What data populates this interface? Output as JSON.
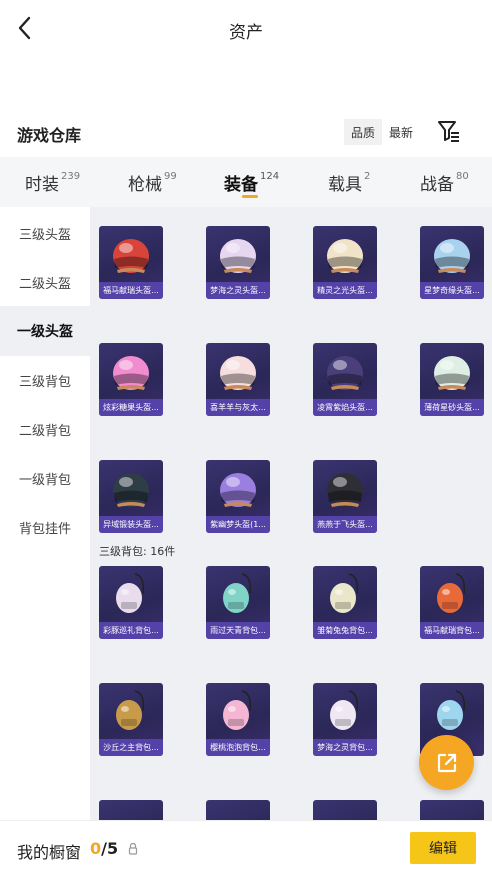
{
  "header": {
    "title": "资产"
  },
  "warehouse": {
    "title": "游戏仓库",
    "sort_options": [
      "品质",
      "最新"
    ],
    "active_sort": 1
  },
  "categories": [
    {
      "label": "时装",
      "count": "239"
    },
    {
      "label": "枪械",
      "count": "99"
    },
    {
      "label": "装备",
      "count": "124"
    },
    {
      "label": "载具",
      "count": "2"
    },
    {
      "label": "战备",
      "count": "80"
    }
  ],
  "sidebar": {
    "items": [
      {
        "label": "三级头盔"
      },
      {
        "label": "二级头盔"
      },
      {
        "label": "一级头盔"
      },
      {
        "label": "三级背包"
      },
      {
        "label": "二级背包"
      },
      {
        "label": "一级背包"
      },
      {
        "label": "背包挂件"
      }
    ]
  },
  "helmets": [
    {
      "name": "福马献瑞头盔...",
      "color": "#d9443a"
    },
    {
      "name": "梦海之灵头盔...",
      "color": "#e6d6f0"
    },
    {
      "name": "精灵之光头盔...",
      "color": "#f1e3c8"
    },
    {
      "name": "星梦奇缘头盔...",
      "color": "#a9d2ee"
    },
    {
      "name": "炫彩糖果头盔...",
      "color": "#f08ccf"
    },
    {
      "name": "喜羊羊与灰太...",
      "color": "#f6dede"
    },
    {
      "name": "凌霄紫焰头盔...",
      "color": "#4a3f7a"
    },
    {
      "name": "薄荷星砂头盔...",
      "color": "#dfeee5"
    },
    {
      "name": "异域锻装头盔...",
      "color": "#2f3d46"
    },
    {
      "name": "紫幽梦头盔(1...",
      "color": "#9a7fe0"
    },
    {
      "name": "燕燕于飞头盔...",
      "color": "#2e2e36"
    }
  ],
  "backpack_section": {
    "title": "三级背包: 16件"
  },
  "backpacks": [
    {
      "name": "彩豚巡礼背包...",
      "color": "#e8dced"
    },
    {
      "name": "雨过天青背包...",
      "color": "#7fd3c7"
    },
    {
      "name": "雏菊兔兔背包...",
      "color": "#e9e6c9"
    },
    {
      "name": "福马献瑞背包...",
      "color": "#e86a3a"
    },
    {
      "name": "沙丘之主背包...",
      "color": "#c89b4a"
    },
    {
      "name": "樱桃泡泡背包...",
      "color": "#f4b6d2"
    },
    {
      "name": "梦海之灵背包...",
      "color": "#efe8f4"
    },
    {
      "name": "",
      "color": "#9fd6ef"
    }
  ],
  "showcase": {
    "label": "我的橱窗",
    "current": "0",
    "total": "/5",
    "edit_label": "编辑"
  },
  "colors": {
    "accent": "#f5a623",
    "edit_button": "#f5c518"
  }
}
